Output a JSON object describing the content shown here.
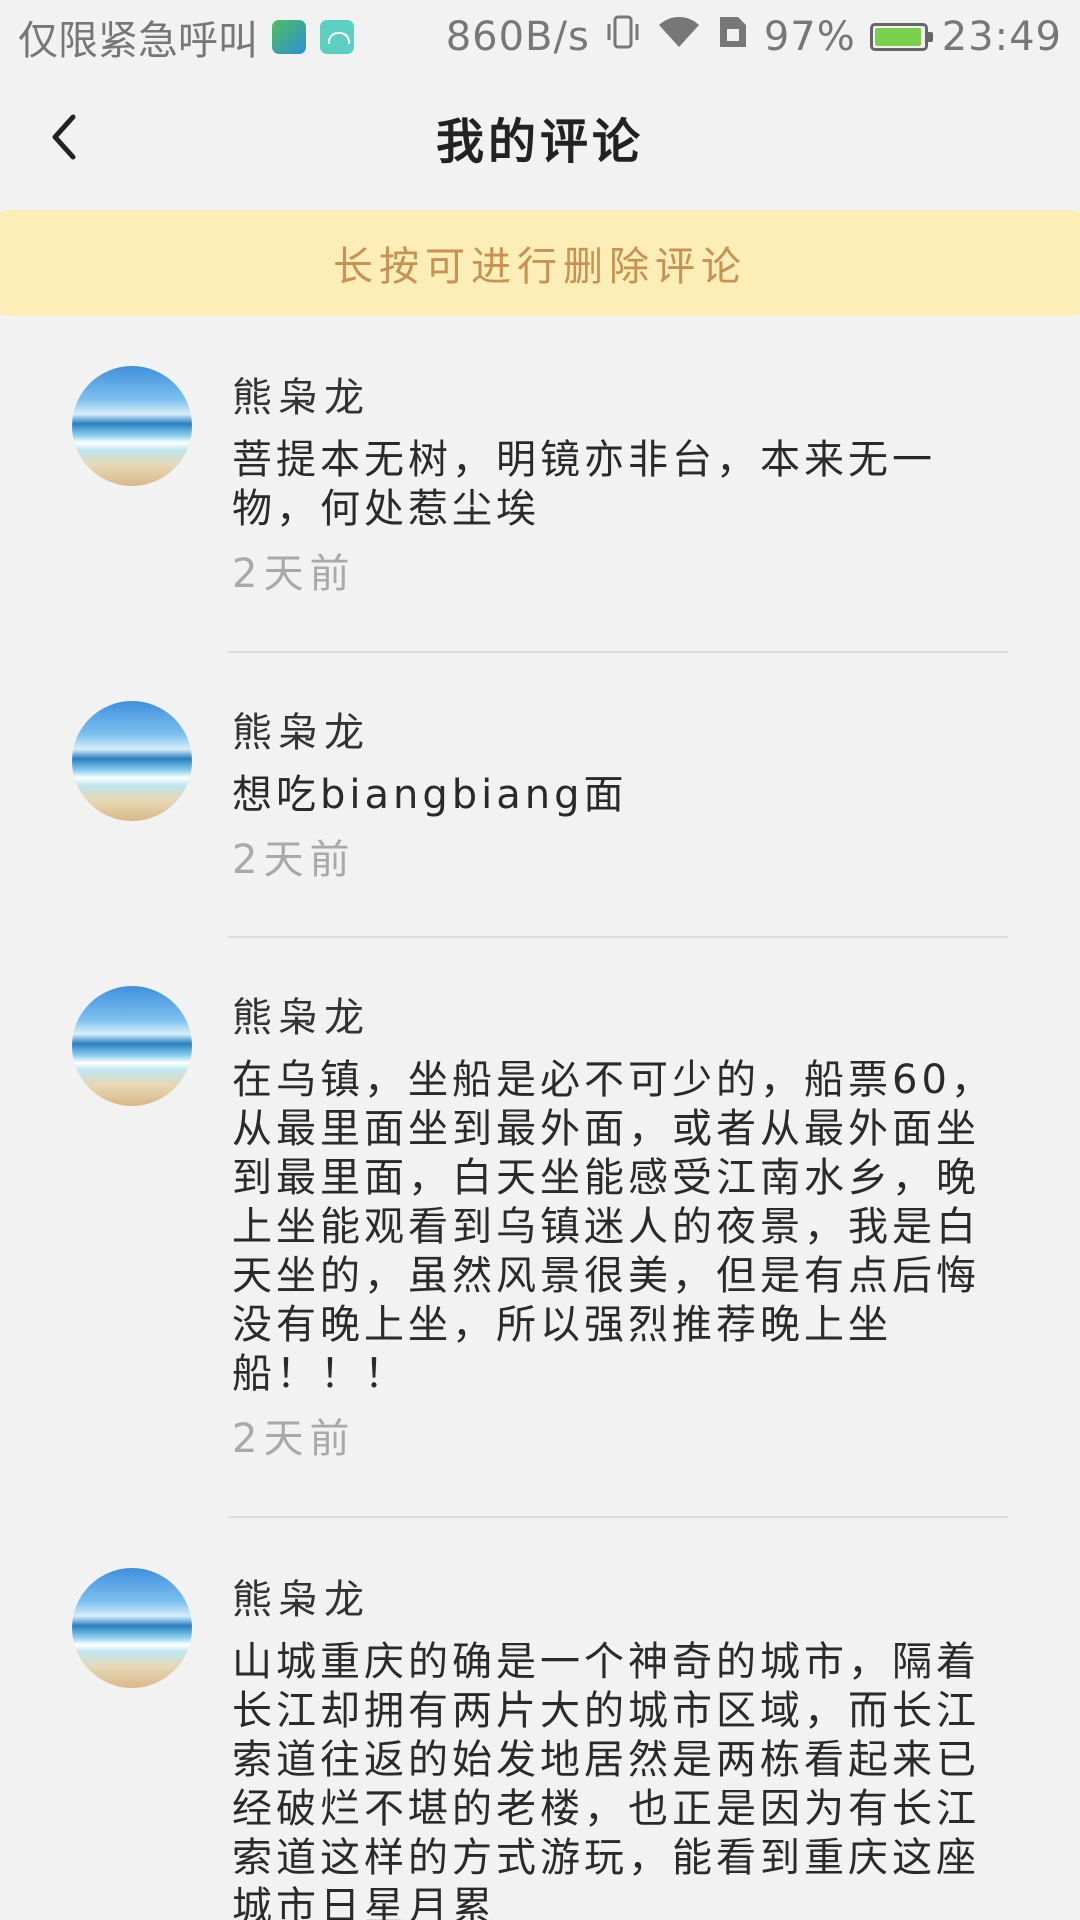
{
  "status_bar": {
    "carrier": "仅限紧急呼叫",
    "speed": "860B/s",
    "battery": "97%",
    "battery_level": 0.97,
    "time": "23:49",
    "icons": [
      "app-icon-map",
      "app-icon-android",
      "vibrate-icon",
      "wifi-icon",
      "sim-icon",
      "battery-icon"
    ]
  },
  "header": {
    "back_icon": "chevron-left-icon",
    "title": "我的评论"
  },
  "notice": {
    "text": "长按可进行删除评论"
  },
  "comments": [
    {
      "author": "熊枭龙",
      "content": "菩提本无树，明镜亦非台，本来无一物，何处惹尘埃",
      "time": "2天前"
    },
    {
      "author": "熊枭龙",
      "content": "想吃biangbiang面",
      "time": "2天前"
    },
    {
      "author": "熊枭龙",
      "content": "在乌镇，坐船是必不可少的，船票60，从最里面坐到最外面，或者从最外面坐到最里面，白天坐能感受江南水乡，晚上坐能观看到乌镇迷人的夜景，我是白天坐的，虽然风景很美，但是有点后悔没有晚上坐，所以强烈推荐晚上坐船！！！",
      "time": "2天前"
    },
    {
      "author": "熊枭龙",
      "content": "山城重庆的确是一个神奇的城市，隔着长江却拥有两片大的城市区域，而长江索道往返的始发地居然是两栋看起来已经破烂不堪的老楼，也正是因为有长江索道这样的方式游玩，能看到重庆这座城市日星月累",
      "time": ""
    }
  ],
  "colors": {
    "background": "#f2f2f2",
    "notice_bg": "#fdedb6",
    "notice_text": "#c99152",
    "time_text": "#a9a9a9"
  }
}
